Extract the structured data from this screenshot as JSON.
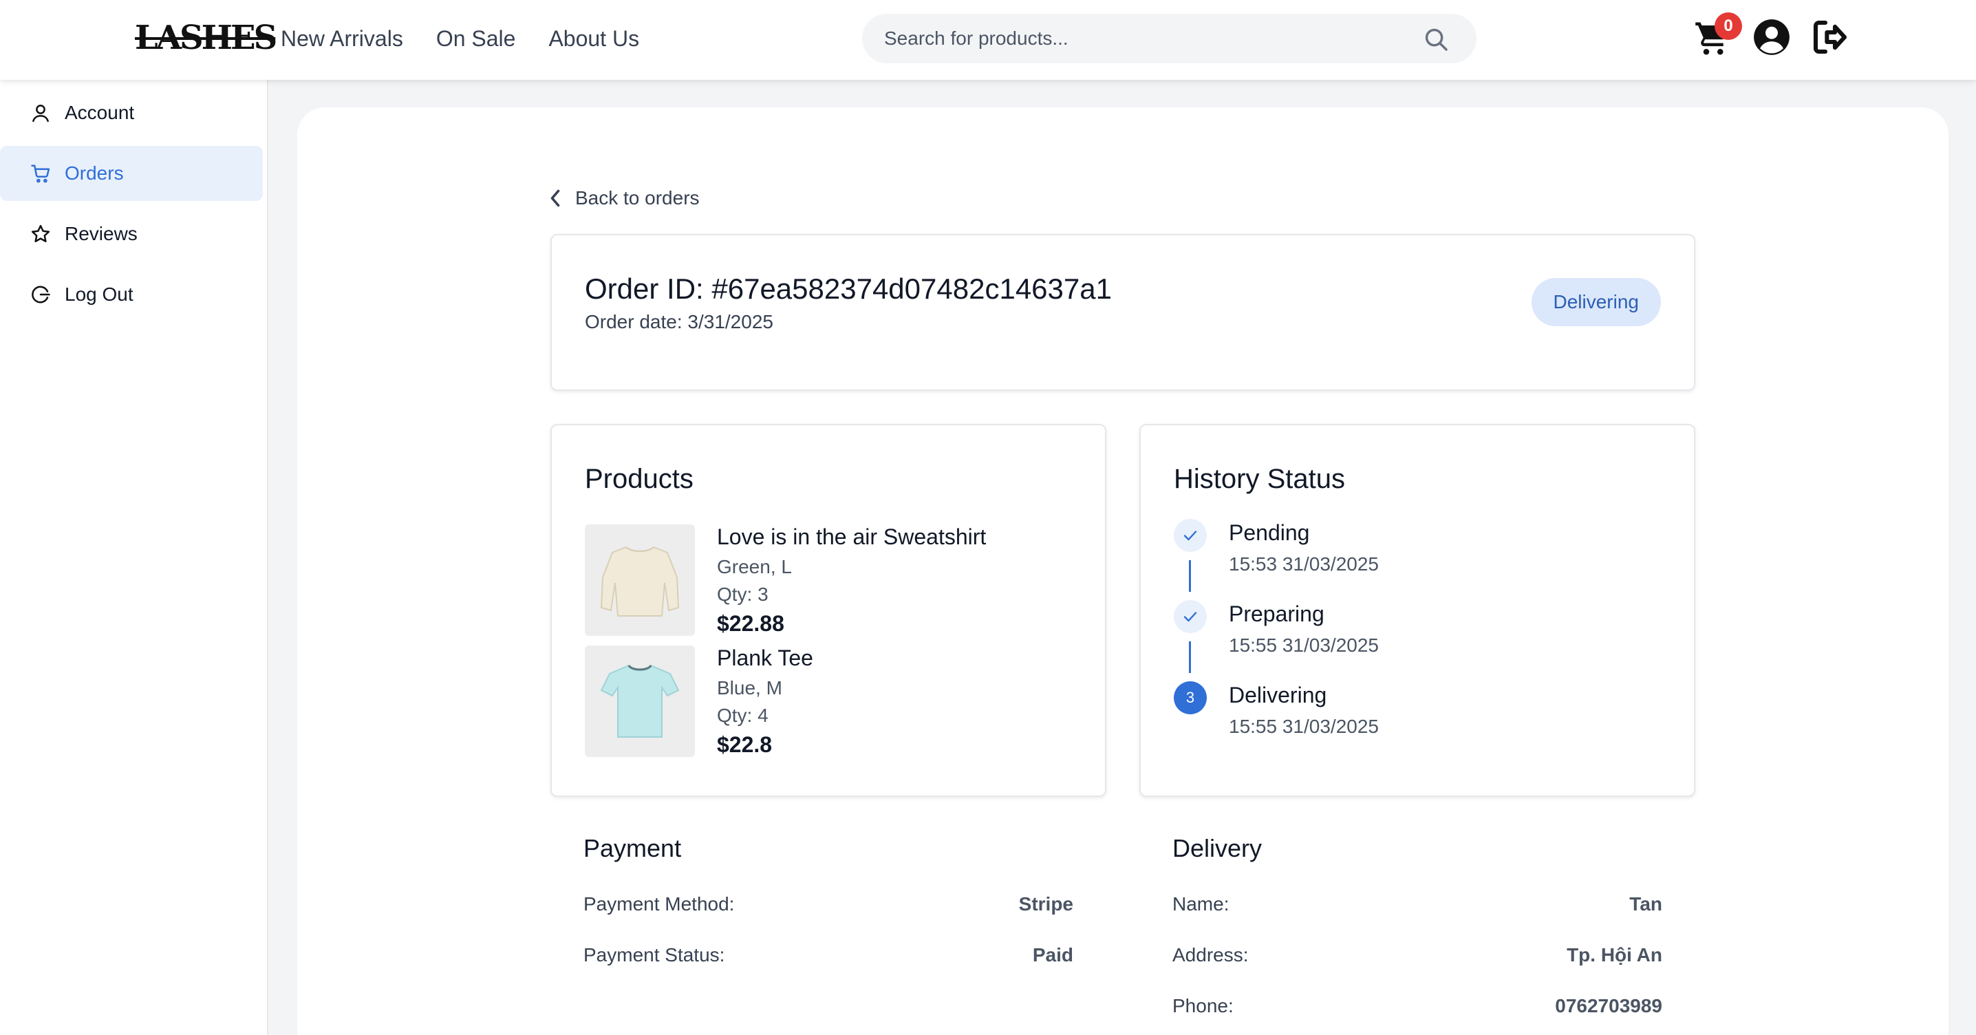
{
  "brand": {
    "logo_text": "LASHES"
  },
  "nav": {
    "links": [
      "New Arrivals",
      "On Sale",
      "About Us"
    ]
  },
  "search": {
    "placeholder": "Search for products..."
  },
  "header_actions": {
    "cart_count": "0"
  },
  "sidebar": {
    "items": [
      {
        "label": "Account",
        "icon": "user-icon"
      },
      {
        "label": "Orders",
        "icon": "cart-icon",
        "active": true
      },
      {
        "label": "Reviews",
        "icon": "star-icon"
      },
      {
        "label": "Log Out",
        "icon": "logout-icon"
      }
    ]
  },
  "order": {
    "back_label": "Back to orders",
    "id_label": "Order ID: #67ea582374d07482c14637a1",
    "date_label": "Order date: 3/31/2025",
    "status": "Delivering"
  },
  "products": {
    "title": "Products",
    "items": [
      {
        "name": "Love is in the air Sweatshirt",
        "variant": "Green, L",
        "qty": "Qty: 3",
        "price": "$22.88"
      },
      {
        "name": "Plank Tee",
        "variant": "Blue, M",
        "qty": "Qty: 4",
        "price": "$22.8"
      }
    ]
  },
  "history": {
    "title": "History Status",
    "steps": [
      {
        "name": "Pending",
        "time": "15:53 31/03/2025",
        "state": "done"
      },
      {
        "name": "Preparing",
        "time": "15:55 31/03/2025",
        "state": "done"
      },
      {
        "name": "Delivering",
        "time": "15:55 31/03/2025",
        "state": "current",
        "number": "3"
      }
    ]
  },
  "payment": {
    "title": "Payment",
    "rows": [
      {
        "label": "Payment Method:",
        "value": "Stripe"
      },
      {
        "label": "Payment Status:",
        "value": "Paid"
      }
    ]
  },
  "delivery": {
    "title": "Delivery",
    "rows": [
      {
        "label": "Name:",
        "value": "Tan"
      },
      {
        "label": "Address:",
        "value": "Tp. Hội An"
      },
      {
        "label": "Phone:",
        "value": "0762703989"
      }
    ]
  },
  "colors": {
    "accent": "#2f6fd6",
    "badge": "#e53935",
    "status_pill_bg": "#dbe7fb"
  }
}
